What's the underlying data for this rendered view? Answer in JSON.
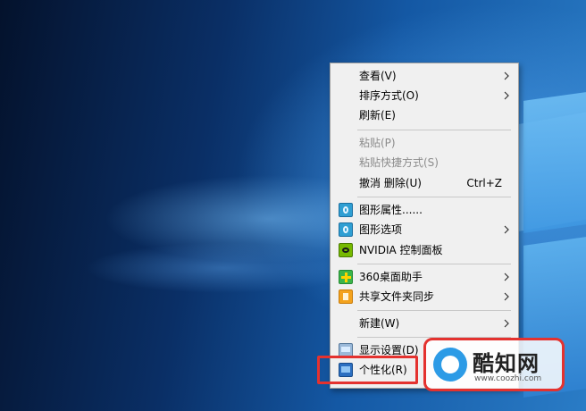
{
  "menu": {
    "items": [
      {
        "label": "查看(V)",
        "submenu": true,
        "disabled": false,
        "icon": ""
      },
      {
        "label": "排序方式(O)",
        "submenu": true,
        "disabled": false,
        "icon": ""
      },
      {
        "label": "刷新(E)",
        "submenu": false,
        "disabled": false,
        "icon": ""
      },
      {
        "label": "粘贴(P)",
        "submenu": false,
        "disabled": true,
        "icon": ""
      },
      {
        "label": "粘贴快捷方式(S)",
        "submenu": false,
        "disabled": true,
        "icon": ""
      },
      {
        "label": "撤消 删除(U)",
        "shortcut": "Ctrl+Z",
        "submenu": false,
        "disabled": false,
        "icon": ""
      },
      {
        "label": "图形属性......",
        "submenu": false,
        "disabled": false,
        "icon": "intel-graphics-icon"
      },
      {
        "label": "图形选项",
        "submenu": true,
        "disabled": false,
        "icon": "intel-graphics-icon"
      },
      {
        "label": "NVIDIA 控制面板",
        "submenu": false,
        "disabled": false,
        "icon": "nvidia-icon"
      },
      {
        "label": "360桌面助手",
        "submenu": true,
        "disabled": false,
        "icon": "360-icon"
      },
      {
        "label": "共享文件夹同步",
        "submenu": true,
        "disabled": false,
        "icon": "share-sync-icon"
      },
      {
        "label": "新建(W)",
        "submenu": true,
        "disabled": false,
        "icon": ""
      },
      {
        "label": "显示设置(D)",
        "submenu": false,
        "disabled": false,
        "icon": "display-settings-icon"
      },
      {
        "label": "个性化(R)",
        "submenu": false,
        "disabled": false,
        "icon": "personalize-icon"
      }
    ]
  },
  "watermark": {
    "title": "酷知网",
    "url": "www.coozhi.com"
  },
  "colors": {
    "highlight": "#e4322f",
    "menu_bg": "#f0f0f0",
    "disabled_text": "#8c8c8c"
  }
}
